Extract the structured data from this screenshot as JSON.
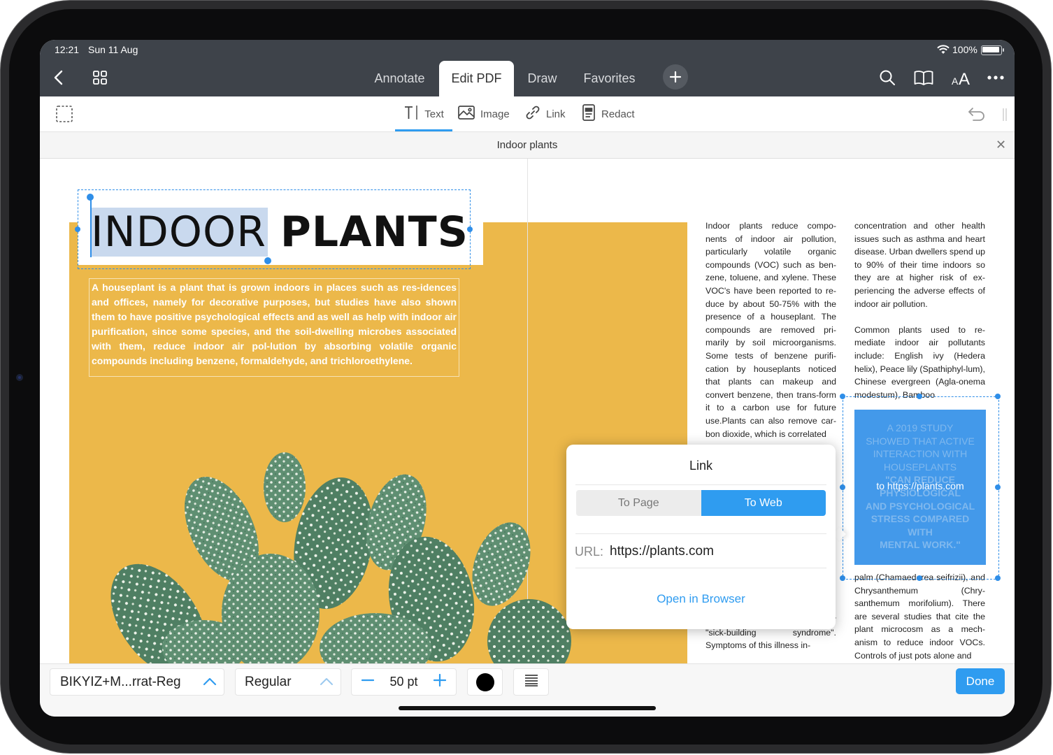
{
  "status_bar": {
    "time": "12:21",
    "date": "Sun 11 Aug",
    "battery": "100%"
  },
  "nav": {
    "tabs": [
      "Annotate",
      "Edit PDF",
      "Draw",
      "Favorites"
    ],
    "active_tab": "Edit PDF",
    "icons": [
      "back-icon",
      "grid-icon",
      "plus-icon",
      "search-icon",
      "book-icon",
      "text-size-icon",
      "more-icon"
    ]
  },
  "toolbar": {
    "text_label": "Text",
    "image_label": "Image",
    "link_label": "Link",
    "redact_label": "Redact",
    "active": "Text"
  },
  "document": {
    "title": "Indoor plants"
  },
  "page": {
    "heading_light": "INDOOR",
    "heading_bold": "PLANTS",
    "intro": "A houseplant is a plant that is grown indoors in places such as res-idences and offices, namely for decorative purposes, but studies have also shown them to have positive psychological effects and as well as help with indoor air purification, since some species, and the soil-dwelling microbes associated with them, reduce indoor air pol-lution by absorbing volatile organic compounds including benzene, formaldehyde, and trichloroethylene.",
    "col1_top": "Indoor plants reduce compo-nents of indoor air pollution, particularly volatile organic compounds (VOC) such as ben-zene, toluene, and xylene. These VOC's have been reported to re-duce by about 50-75% with the presence of a houseplant. The compounds are removed pri-marily by soil microorganisms. Some tests of benzene purifi-cation by houseplants noticed that plants can makeup and convert benzene, then trans-form it to a carbon use for future use.Plants can also remove car-bon dioxide, which is correlated",
    "col1_bottom": "for \"building-related illness\" or \"sick-building syndrome\". Symptoms of this illness in-",
    "col2_top": "concentration and other health issues such as asthma and heart disease. Urban dwellers spend up to 90% of their time indoors so they are at higher risk of ex-periencing the adverse effects of indoor air pollution.",
    "col2_mid": "Common plants used to re-mediate indoor air pollutants include: English ivy (Hedera helix), Peace lily (Spathiphyl-lum), Chinese evergreen (Agla-onema modestum), Bamboo",
    "col2_bottom": "palm (Chamaedorea seifrizii), and Chrysanthemum (Chry-santhemum morifolium). There are several studies that cite the plant microcosm as a mech-anism to reduce indoor VOCs. Controls of just pots alone and",
    "quote_lines": [
      "A 2019 STUDY",
      "SHOWED THAT ACTIVE",
      "INTERACTION WITH",
      "HOUSEPLANTS",
      "\"CAN REDUCE",
      "PHYSIOLOGICAL",
      "AND PSYCHOLOGICAL",
      "STRESS COMPARED",
      "WITH",
      "MENTAL WORK.\""
    ],
    "link_overlay": "to https://plants.com"
  },
  "link_popover": {
    "title": "Link",
    "segment_to_page": "To Page",
    "segment_to_web": "To Web",
    "selected_segment": "To Web",
    "url_label": "URL:",
    "url_value": "https://plants.com",
    "open_label": "Open in Browser"
  },
  "bottom_bar": {
    "font_name": "BIKYIZ+M...rrat-Reg",
    "font_style": "Regular",
    "font_size": "50 pt",
    "text_color": "#000000",
    "done_label": "Done"
  },
  "colors": {
    "accent": "#2f9cf0",
    "topbar": "#3e434a",
    "page_yellow": "#ecb84a"
  }
}
